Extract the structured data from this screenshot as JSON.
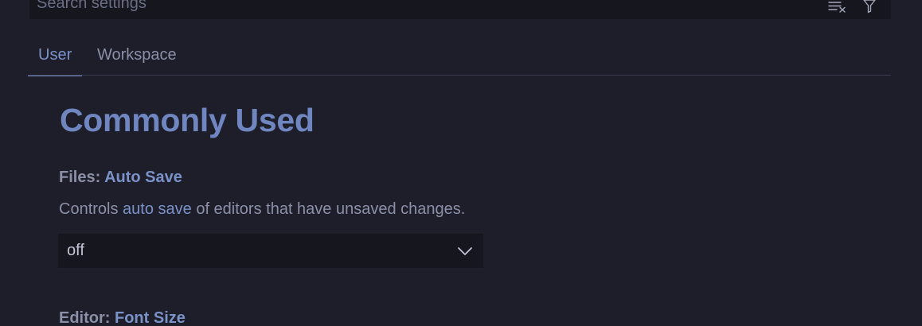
{
  "search": {
    "placeholder": "Search settings",
    "actions": [
      {
        "icon": "clear-filter-icon"
      },
      {
        "icon": "filter-icon"
      }
    ]
  },
  "tabs": [
    {
      "label": "User",
      "active": true
    },
    {
      "label": "Workspace",
      "active": false
    }
  ],
  "section": {
    "title": "Commonly Used"
  },
  "settings": [
    {
      "category": "Files: ",
      "name": "Auto Save",
      "description_before": "Controls ",
      "description_link": "auto save",
      "description_after": " of editors that have unsaved changes.",
      "value": "off"
    },
    {
      "category": "Editor: ",
      "name": "Font Size"
    }
  ],
  "colors": {
    "background": "#1e1e2a",
    "input_background": "#16161e",
    "accent": "#7a92c8",
    "muted_text": "#8b90a8"
  }
}
